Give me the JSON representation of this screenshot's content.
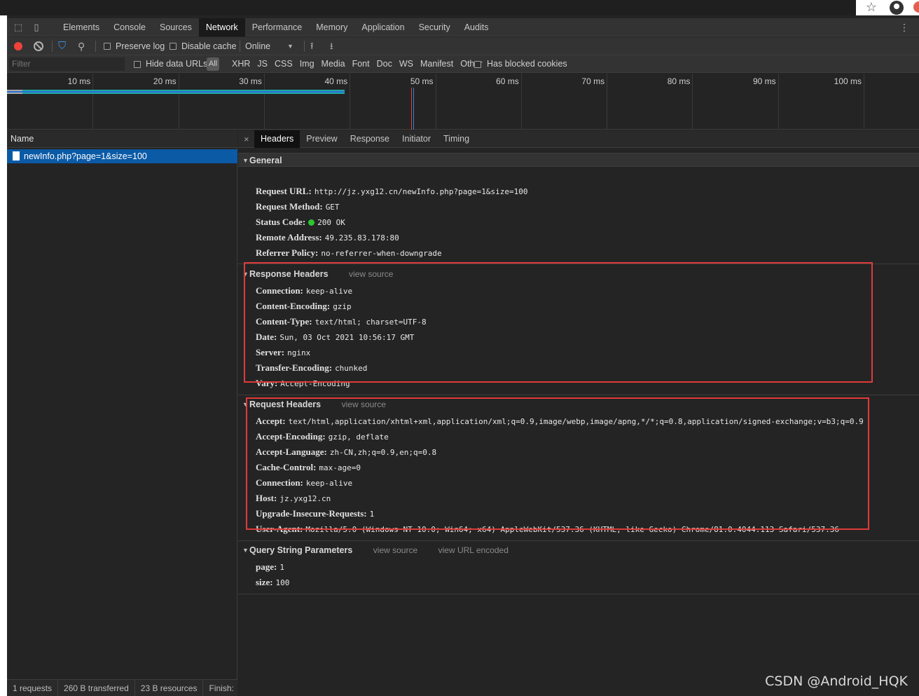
{
  "browser": {
    "star_icon": "star-icon",
    "account_icon": "account-icon"
  },
  "devtools_tabs": [
    "Elements",
    "Console",
    "Sources",
    "Network",
    "Performance",
    "Memory",
    "Application",
    "Security",
    "Audits"
  ],
  "active_tab": "Network",
  "toolbar": {
    "preserve_log": "Preserve log",
    "disable_cache": "Disable cache",
    "throttle": "Online",
    "throttle_arrow": "▼"
  },
  "filter": {
    "placeholder": "Filter",
    "hide_data_urls": "Hide data URLs",
    "all": "All",
    "types": [
      "XHR",
      "JS",
      "CSS",
      "Img",
      "Media",
      "Font",
      "Doc",
      "WS",
      "Manifest",
      "Other"
    ],
    "has_blocked_cookies": "Has blocked cookies"
  },
  "overview": {
    "ticks": [
      "10 ms",
      "20 ms",
      "30 ms",
      "40 ms",
      "50 ms",
      "60 ms",
      "70 ms",
      "80 ms",
      "90 ms",
      "100 ms"
    ]
  },
  "request_list": {
    "column_name": "Name",
    "request": "newInfo.php?page=1&size=100",
    "status": [
      "1 requests",
      "260 B transferred",
      "23 B resources",
      "Finish:"
    ]
  },
  "detail": {
    "close": "×",
    "tabs": [
      "Headers",
      "Preview",
      "Response",
      "Initiator",
      "Timing"
    ],
    "active_tab": "Headers",
    "general": {
      "title": "General",
      "lines": [
        {
          "k": "Request URL:",
          "v": "http://jz.yxg12.cn/newInfo.php?page=1&size=100"
        },
        {
          "k": "Request Method:",
          "v": "GET"
        },
        {
          "k": "Status Code:",
          "v": "200 OK"
        },
        {
          "k": "Remote Address:",
          "v": "49.235.83.178:80"
        },
        {
          "k": "Referrer Policy:",
          "v": "no-referrer-when-downgrade"
        }
      ]
    },
    "response_headers": {
      "title": "Response Headers",
      "view_source": "view source",
      "lines": [
        {
          "k": "Connection:",
          "v": "keep-alive"
        },
        {
          "k": "Content-Encoding:",
          "v": "gzip"
        },
        {
          "k": "Content-Type:",
          "v": "text/html; charset=UTF-8"
        },
        {
          "k": "Date:",
          "v": "Sun, 03 Oct 2021 10:56:17 GMT"
        },
        {
          "k": "Server:",
          "v": "nginx"
        },
        {
          "k": "Transfer-Encoding:",
          "v": "chunked"
        },
        {
          "k": "Vary:",
          "v": "Accept-Encoding"
        }
      ]
    },
    "request_headers": {
      "title": "Request Headers",
      "view_source": "view source",
      "lines": [
        {
          "k": "Accept:",
          "v": "text/html,application/xhtml+xml,application/xml;q=0.9,image/webp,image/apng,*/*;q=0.8,application/signed-exchange;v=b3;q=0.9"
        },
        {
          "k": "Accept-Encoding:",
          "v": "gzip, deflate"
        },
        {
          "k": "Accept-Language:",
          "v": "zh-CN,zh;q=0.9,en;q=0.8"
        },
        {
          "k": "Cache-Control:",
          "v": "max-age=0"
        },
        {
          "k": "Connection:",
          "v": "keep-alive"
        },
        {
          "k": "Host:",
          "v": "jz.yxg12.cn"
        },
        {
          "k": "Upgrade-Insecure-Requests:",
          "v": "1"
        },
        {
          "k": "User-Agent:",
          "v": "Mozilla/5.0 (Windows NT 10.0; Win64; x64) AppleWebKit/537.36 (KHTML, like Gecko) Chrome/81.0.4044.113 Safari/537.36"
        }
      ]
    },
    "query_params": {
      "title": "Query String Parameters",
      "view_source": "view source",
      "view_url_encoded": "view URL encoded",
      "lines": [
        {
          "k": "page:",
          "v": "1"
        },
        {
          "k": "size:",
          "v": "100"
        }
      ]
    }
  },
  "watermark": "CSDN @Android_HQK",
  "colors": {
    "accent": "#0b5aa6",
    "highlight_box": "#e03a3a",
    "record": "#f0423b",
    "status_ok": "#2fc42f"
  }
}
